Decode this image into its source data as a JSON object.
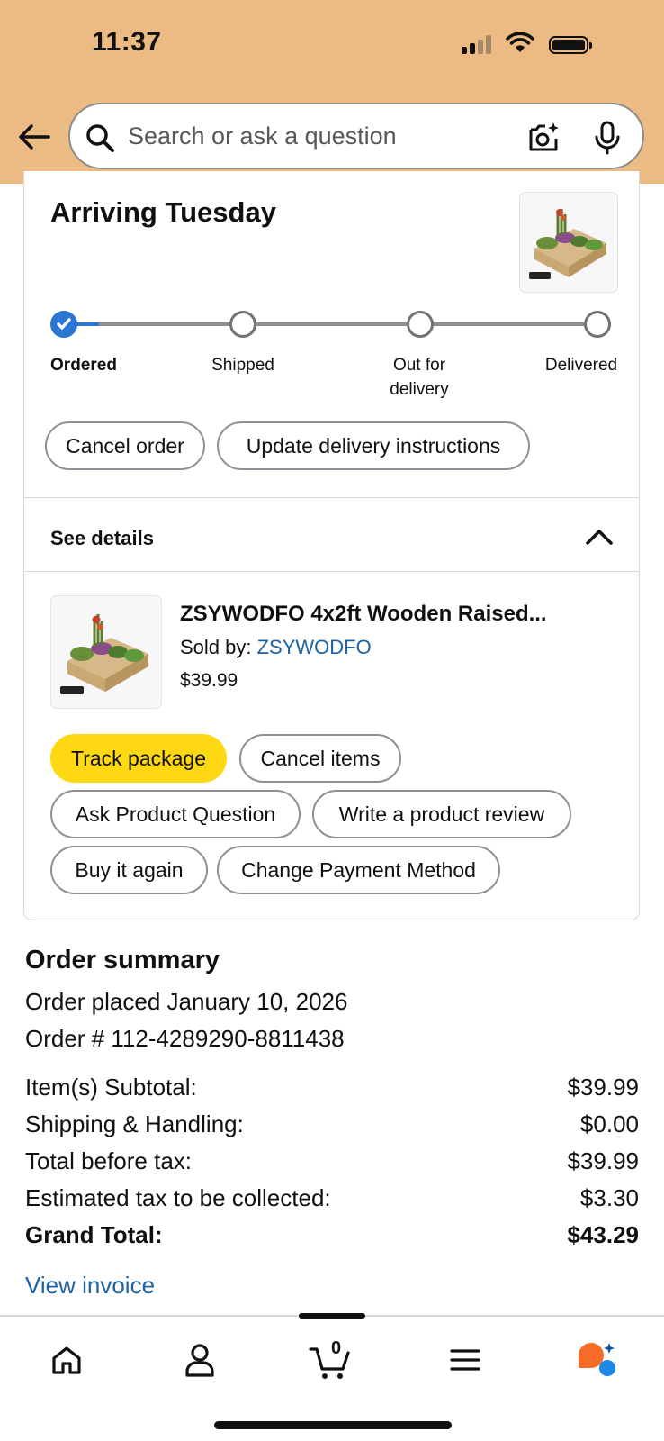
{
  "status_bar": {
    "time": "11:37"
  },
  "search": {
    "placeholder": "Search or ask a question"
  },
  "delivery": {
    "heading": "Arriving Tuesday",
    "steps": [
      {
        "label": "Ordered",
        "done": true
      },
      {
        "label": "Shipped",
        "done": false
      },
      {
        "label": "Out for delivery",
        "done": false
      },
      {
        "label": "Delivered",
        "done": false
      }
    ],
    "actions": {
      "cancel_order": "Cancel order",
      "update_instructions": "Update delivery instructions"
    }
  },
  "details": {
    "toggle_label": "See details",
    "product": {
      "title": "ZSYWODFO 4x2ft Wooden Raised...",
      "sold_by_label": "Sold by: ",
      "seller": "ZSYWODFO",
      "price": "$39.99"
    },
    "buttons": {
      "track": "Track package",
      "cancel_items": "Cancel items",
      "ask_question": "Ask Product Question",
      "write_review": "Write a product review",
      "buy_again": "Buy it again",
      "change_payment": "Change Payment Method"
    }
  },
  "order_summary": {
    "title": "Order summary",
    "placed": "Order placed January 10, 2026",
    "order_number": "Order # 112-4289290-8811438",
    "rows": [
      {
        "label": "Item(s) Subtotal:",
        "value": "$39.99"
      },
      {
        "label": "Shipping & Handling:",
        "value": "$0.00"
      },
      {
        "label": "Total before tax:",
        "value": "$39.99"
      },
      {
        "label": "Estimated tax to be collected:",
        "value": "$3.30"
      },
      {
        "label": "Grand Total:",
        "value": "$43.29"
      }
    ],
    "invoice_link": "View invoice"
  },
  "bottom_nav": {
    "items": [
      "home-icon",
      "account-icon",
      "cart-icon",
      "menu-icon",
      "assistant-icon"
    ],
    "cart_count": "0"
  },
  "colors": {
    "header_bg": "#ecbb83",
    "primary_button": "#ffd814",
    "link": "#2162a1",
    "progress": "#2a76d2"
  }
}
